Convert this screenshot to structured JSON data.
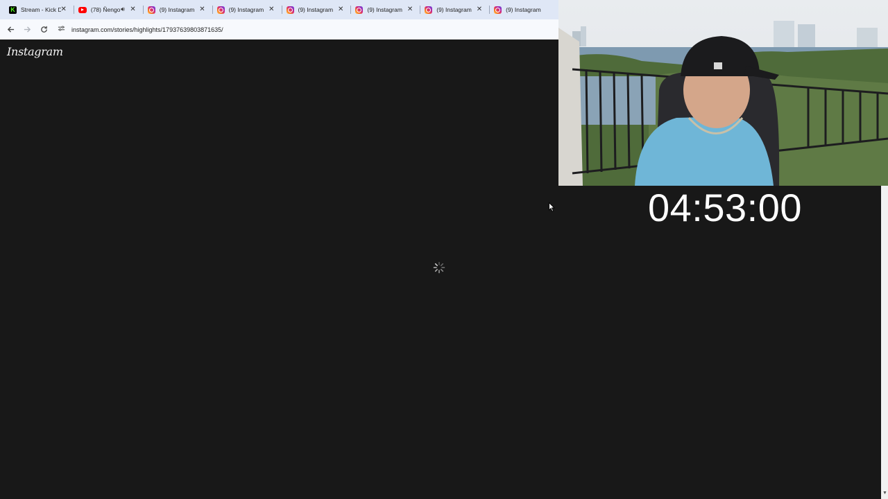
{
  "browser": {
    "tabs": [
      {
        "favicon": "kick-icon",
        "title": "Stream - Kick D",
        "audio": false
      },
      {
        "favicon": "youtube-icon",
        "title": "(78) Ñengo",
        "audio": true
      },
      {
        "favicon": "instagram-icon",
        "title": "(9) Instagram",
        "audio": false
      },
      {
        "favicon": "instagram-icon",
        "title": "(9) Instagram",
        "audio": false
      },
      {
        "favicon": "instagram-icon",
        "title": "(9) Instagram",
        "audio": false
      },
      {
        "favicon": "instagram-icon",
        "title": "(9) Instagram",
        "audio": false
      },
      {
        "favicon": "instagram-icon",
        "title": "(9) Instagram",
        "audio": false
      },
      {
        "favicon": "instagram-icon",
        "title": "(9) Instagram",
        "audio": false
      }
    ],
    "close_glyph": "✕",
    "url": "instagram.com/stories/highlights/17937639803871635/"
  },
  "page": {
    "logo_text": "Instagram"
  },
  "overlay": {
    "timer": "04:53:00"
  },
  "colors": {
    "chrome_bg": "#dfe7f6",
    "page_bg": "#181818",
    "timer_text": "#ffffff"
  }
}
